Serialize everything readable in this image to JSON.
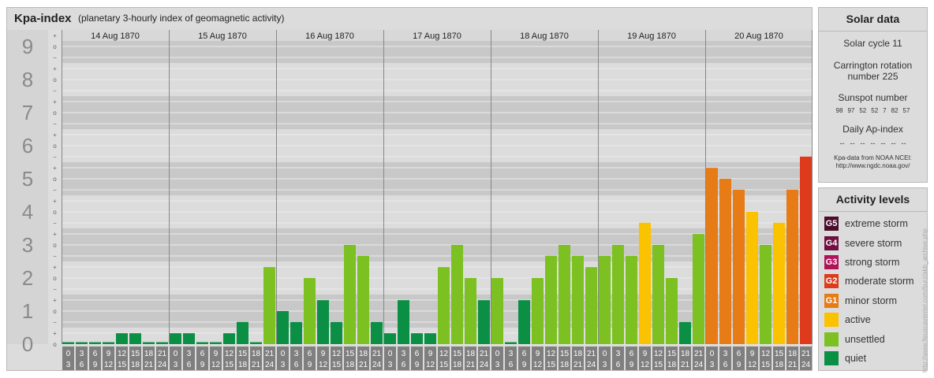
{
  "header": {
    "title": "Kpa-index",
    "subtitle": "(planetary 3-hourly index of geomagnetic activity)"
  },
  "chart_data": {
    "type": "bar",
    "y_ticks": [
      "0",
      "1",
      "2",
      "3",
      "4",
      "5",
      "6",
      "7",
      "8",
      "9"
    ],
    "y_sub_marks": [
      "o",
      "+",
      "−"
    ],
    "ylim": [
      0,
      9
    ],
    "days": [
      "14 Aug 1870",
      "15 Aug 1870",
      "16 Aug 1870",
      "17 Aug 1870",
      "18 Aug 1870",
      "19 Aug 1870",
      "20 Aug 1870"
    ],
    "interval_start": [
      "0",
      "3",
      "6",
      "9",
      "12",
      "15",
      "18",
      "21"
    ],
    "interval_end": [
      "3",
      "6",
      "9",
      "12",
      "15",
      "18",
      "21",
      "24"
    ],
    "values": [
      [
        0,
        0,
        0,
        0,
        0.33,
        0.33,
        0,
        0
      ],
      [
        0.33,
        0.33,
        0,
        0,
        0.33,
        0.67,
        0,
        2.33
      ],
      [
        1,
        0.67,
        2,
        1.33,
        0.67,
        3,
        2.67,
        0.67
      ],
      [
        0.33,
        1.33,
        0.33,
        0.33,
        2.33,
        3,
        2,
        1.33
      ],
      [
        2,
        0,
        1.33,
        2,
        2.67,
        3,
        2.67,
        2.33
      ],
      [
        2.67,
        3,
        2.67,
        3.67,
        3,
        2,
        0.67,
        3.33
      ],
      [
        5.33,
        5,
        4.67,
        4,
        3,
        3.67,
        4.67,
        5.67
      ]
    ],
    "levels": [
      "quiet",
      "unsettled",
      "active",
      "minor storm",
      "moderate storm"
    ],
    "colors": {
      "quiet": "#0a8f45",
      "unsettled": "#7cc121",
      "active": "#fbc200",
      "minor storm": "#e77b15",
      "moderate storm": "#de3b1c",
      "band_light": "#dcdcdc",
      "band_dark": "#c8c8c8",
      "grid": "#ececec",
      "label": "#8a8a8a"
    },
    "grid": true,
    "legend": "none"
  },
  "solar": {
    "title": "Solar data",
    "cycle": "Solar cycle 11",
    "carrington": "Carrington rotation number 225",
    "sunspot_label": "Sunspot number",
    "sunspot_values": [
      "98",
      "97",
      "52",
      "52",
      "7",
      "82",
      "57"
    ],
    "ap_label": "Daily Ap-index",
    "ap_values": [
      "--",
      "--",
      "--",
      "--",
      "--",
      "--",
      "--"
    ],
    "source_line1": "Kpa-data from NOAA NCEI:",
    "source_line2": "http://www.ngdc.noaa.gov/"
  },
  "levels_panel": {
    "title": "Activity levels",
    "items": [
      {
        "code": "G5",
        "label": "extreme storm",
        "color": "#4a0d2a"
      },
      {
        "code": "G4",
        "label": "severe storm",
        "color": "#6f1040"
      },
      {
        "code": "G3",
        "label": "strong storm",
        "color": "#b1125a"
      },
      {
        "code": "G2",
        "label": "moderate storm",
        "color": "#de3b1c"
      },
      {
        "code": "G1",
        "label": "minor storm",
        "color": "#e77b15"
      },
      {
        "code": "",
        "label": "active",
        "color": "#fbc200"
      },
      {
        "code": "",
        "label": "unsettled",
        "color": "#7cc121"
      },
      {
        "code": "",
        "label": "quiet",
        "color": "#0a8f45"
      }
    ]
  },
  "credit": "http://www.fleuxcaverrier.com/burz/akb_archive.php"
}
